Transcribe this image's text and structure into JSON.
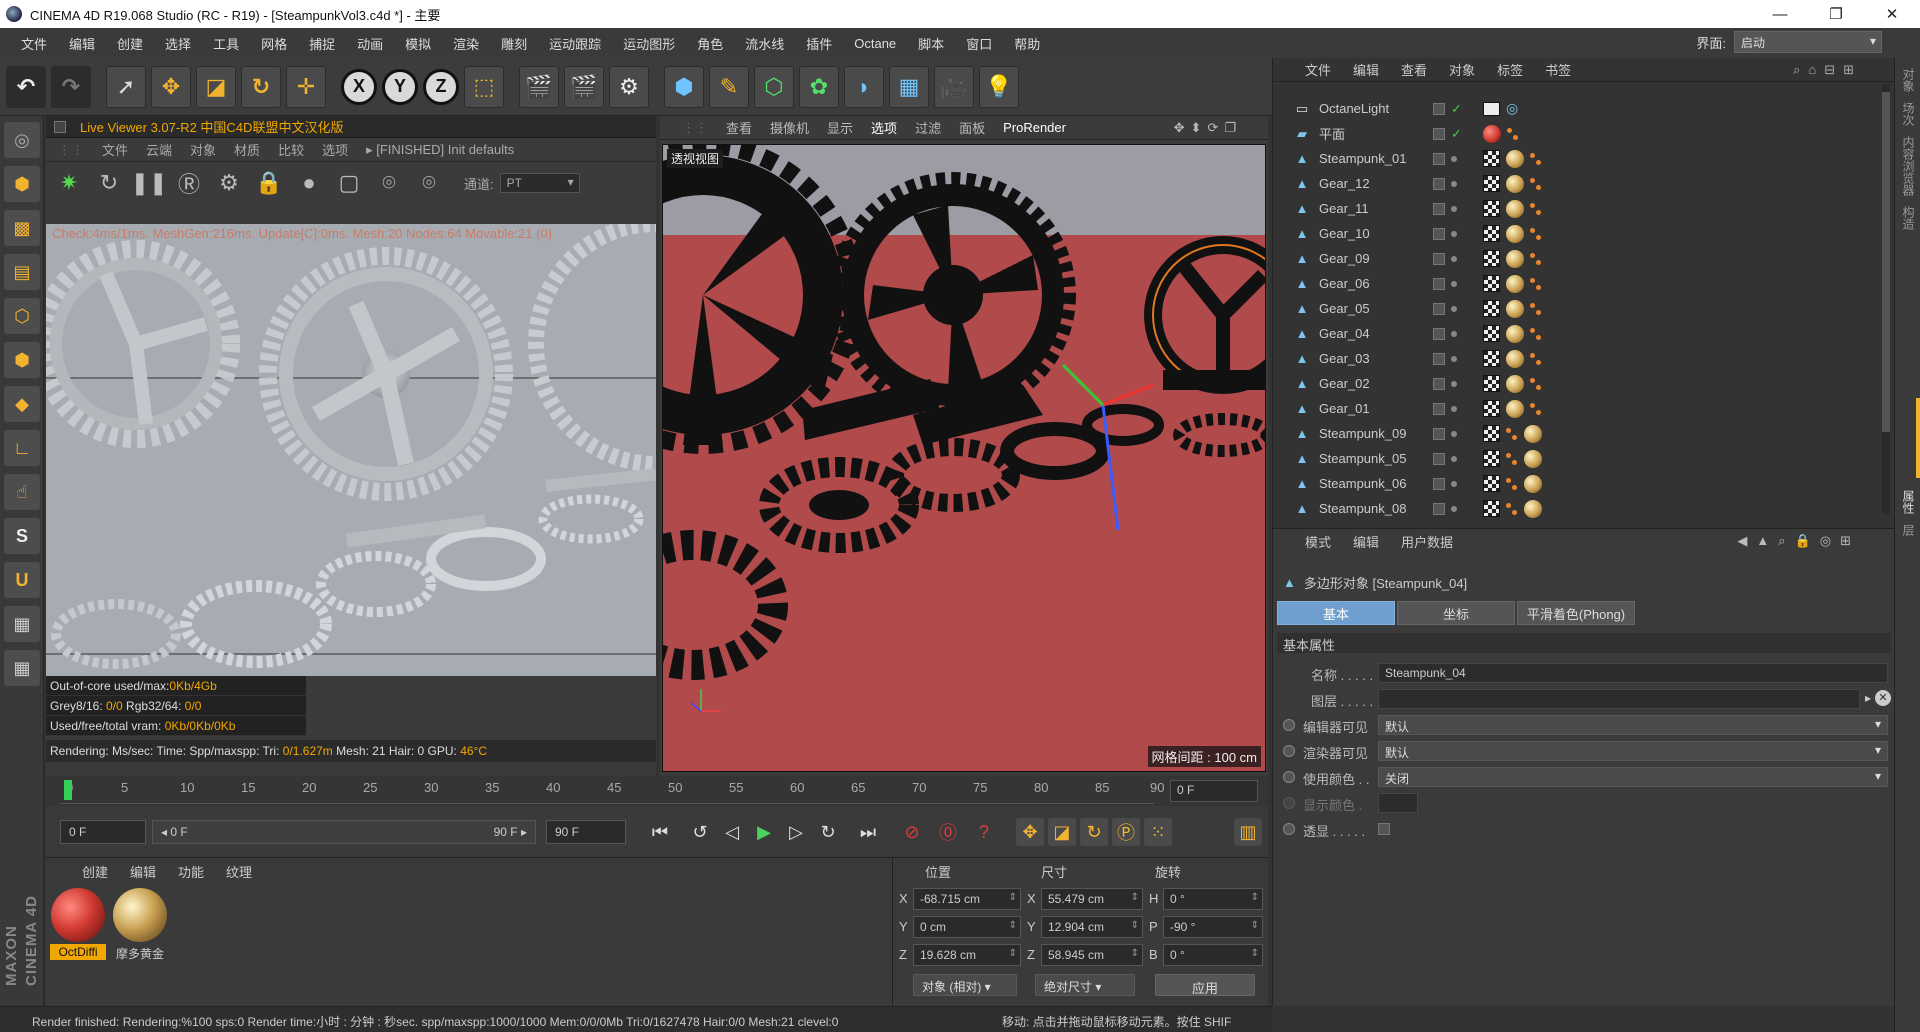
{
  "titlebar": {
    "title": "CINEMA 4D R19.068 Studio (RC - R19) - [SteampunkVol3.c4d *] - 主要",
    "minimize": "—",
    "restore": "❐",
    "close": "✕"
  },
  "menubar": {
    "items": [
      "文件",
      "编辑",
      "创建",
      "选择",
      "工具",
      "网格",
      "捕捉",
      "动画",
      "模拟",
      "渲染",
      "雕刻",
      "运动跟踪",
      "运动图形",
      "角色",
      "流水线",
      "插件",
      "Octane",
      "脚本",
      "窗口",
      "帮助"
    ],
    "interface_label": "界面:",
    "interface_value": "启动"
  },
  "liveviewer": {
    "title": "Live Viewer 3.07-R2 中国C4D联盟中文汉化版",
    "menu": [
      "文件",
      "云端",
      "对象",
      "材质",
      "比较",
      "选项"
    ],
    "menu_status": "▸  [FINISHED] Init defaults",
    "channel_label": "通道:",
    "channel_value": "PT",
    "stat_line": "Check:4ms/1ms. MeshGen:216ms. Update[C]:0ms. Mesh:20 Nodes:64 Movable:21 (0)",
    "info": [
      {
        "k": "Out-of-core used/max:",
        "v": "0Kb/4Gb"
      },
      {
        "k": "Grey8/16: ",
        "v": "0/0",
        "k2": "        Rgb32/64: ",
        "v2": "0/0"
      },
      {
        "k": "Used/free/total vram: ",
        "v": "0Kb/0Kb/0Kb"
      }
    ],
    "render_line": "Rendering:     Ms/sec:      Time:         Spp/maxspp:     Tri: ",
    "render_tri": "0/1.627m",
    "render_rest": "  Mesh: 21   Hair: 0    GPU:  ",
    "render_gpu": "46°C"
  },
  "viewport": {
    "menu": [
      "查看",
      "摄像机",
      "显示",
      "选项",
      "过滤",
      "面板"
    ],
    "prorender": "ProRender",
    "nav_icons": "✥⬍⟳❐",
    "label": "透视视图",
    "grid": "网格间距 : 100 cm"
  },
  "timeline": {
    "ticks": [
      "0",
      "5",
      "10",
      "15",
      "20",
      "25",
      "30",
      "35",
      "40",
      "45",
      "50",
      "55",
      "60",
      "65",
      "70",
      "75",
      "80",
      "85",
      "90"
    ],
    "frame_field": "0 F"
  },
  "transport": {
    "start": "0 F",
    "range_start": "◂ 0 F",
    "range_end": "90 F ▸",
    "end": "90 F"
  },
  "materials": {
    "menu": [
      "创建",
      "编辑",
      "功能",
      "纹理"
    ],
    "items": [
      {
        "name": "OctDiffi",
        "color": "#d23a32"
      },
      {
        "name": "摩多黄金",
        "color": "#c9a052"
      }
    ]
  },
  "coords": {
    "headers": [
      "位置",
      "尺寸",
      "旋转"
    ],
    "rows": [
      {
        "a": "X",
        "pos": "-68.715 cm",
        "b": "X",
        "size": "55.479 cm",
        "c": "H",
        "rot": "0 °"
      },
      {
        "a": "Y",
        "pos": "0 cm",
        "b": "Y",
        "size": "12.904 cm",
        "c": "P",
        "rot": "-90 °"
      },
      {
        "a": "Z",
        "pos": "19.628 cm",
        "b": "Z",
        "size": "58.945 cm",
        "c": "B",
        "rot": "0 °"
      }
    ],
    "mode1": "对象 (相对)  ▾",
    "mode2": "绝对尺寸  ▾",
    "apply": "应用"
  },
  "statusbar": {
    "text": "Render finished: Rendering:%100 sps:0 Render time:小时 : 分钟 : 秒sec. spp/maxspp:1000/1000 Mem:0/0/0Mb Tri:0/1627478 Hair:0/0 Mesh:21 clevel:0",
    "hint": "移动: 点击并拖动鼠标移动元素。按住 SHIF"
  },
  "objects": {
    "menu": [
      "文件",
      "编辑",
      "查看",
      "对象",
      "标签",
      "书签"
    ],
    "items": [
      {
        "name": "OctaneLight",
        "type": "light"
      },
      {
        "name": "平面",
        "type": "plane"
      },
      {
        "name": "Steampunk_01",
        "type": "poly"
      },
      {
        "name": "Gear_12",
        "type": "poly"
      },
      {
        "name": "Gear_11",
        "type": "poly"
      },
      {
        "name": "Gear_10",
        "type": "poly"
      },
      {
        "name": "Gear_09",
        "type": "poly"
      },
      {
        "name": "Gear_06",
        "type": "poly"
      },
      {
        "name": "Gear_05",
        "type": "poly"
      },
      {
        "name": "Gear_04",
        "type": "poly"
      },
      {
        "name": "Gear_03",
        "type": "poly"
      },
      {
        "name": "Gear_02",
        "type": "poly"
      },
      {
        "name": "Gear_01",
        "type": "poly"
      },
      {
        "name": "Steampunk_09",
        "type": "poly"
      },
      {
        "name": "Steampunk_05",
        "type": "poly"
      },
      {
        "name": "Steampunk_06",
        "type": "poly"
      },
      {
        "name": "Steampunk_08",
        "type": "poly"
      }
    ]
  },
  "attributes": {
    "menu": [
      "模式",
      "编辑",
      "用户数据"
    ],
    "object_title": "多边形对象 [Steampunk_04]",
    "tabs": [
      "基本",
      "坐标",
      "平滑着色(Phong)"
    ],
    "section": "基本属性",
    "name_label": "名称 . . . . .",
    "name_value": "Steampunk_04",
    "layer_label": "图层 . . . . .",
    "editor_vis_label": "编辑器可见",
    "editor_vis_value": "默认",
    "render_vis_label": "渲染器可见",
    "render_vis_value": "默认",
    "use_color_label": "使用颜色 . .",
    "use_color_value": "关闭",
    "display_color_label": "显示颜色 .",
    "xray_label": "透显 . . . . ."
  },
  "right_strip": [
    "对象",
    "场次",
    "内容浏览器",
    "构造",
    "属性",
    "层"
  ]
}
